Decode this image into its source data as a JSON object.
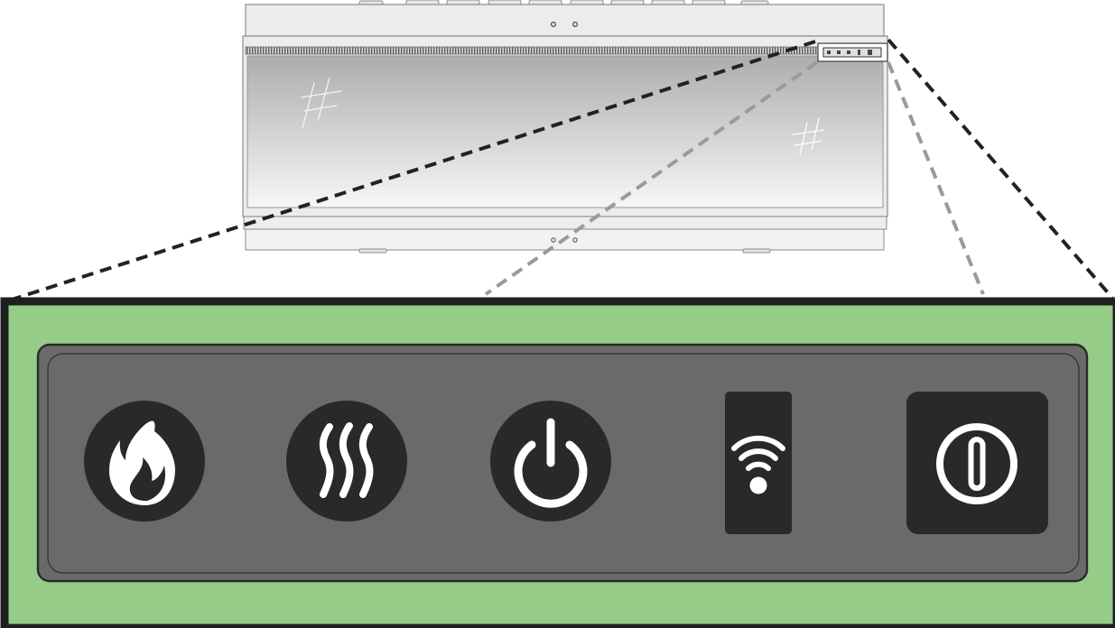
{
  "colors": {
    "panel_background": "#94cc88",
    "control_strip": "#6b6a6b",
    "button_fill": "#292929",
    "icon_fill": "#ffffff",
    "outline": "#1f1f1f",
    "dash_dark": "#222222",
    "dash_light": "#9a9a9a",
    "fireplace_body": "#ececec",
    "fireplace_glass_top": "#adadad",
    "fireplace_glass_bottom": "#f7f7f7"
  },
  "fireplace": {
    "description_name": "electric-fireplace-front-view"
  },
  "control_panel": {
    "buttons": [
      {
        "id": "flame",
        "icon": "flame-icon",
        "shape": "circle"
      },
      {
        "id": "heat",
        "icon": "heat-waves-icon",
        "shape": "circle"
      },
      {
        "id": "power",
        "icon": "power-icon",
        "shape": "circle"
      },
      {
        "id": "wifi",
        "icon": "wifi-icon",
        "shape": "rounded-rect"
      },
      {
        "id": "main-switch",
        "icon": "main-switch-icon",
        "shape": "rounded-square"
      }
    ]
  }
}
